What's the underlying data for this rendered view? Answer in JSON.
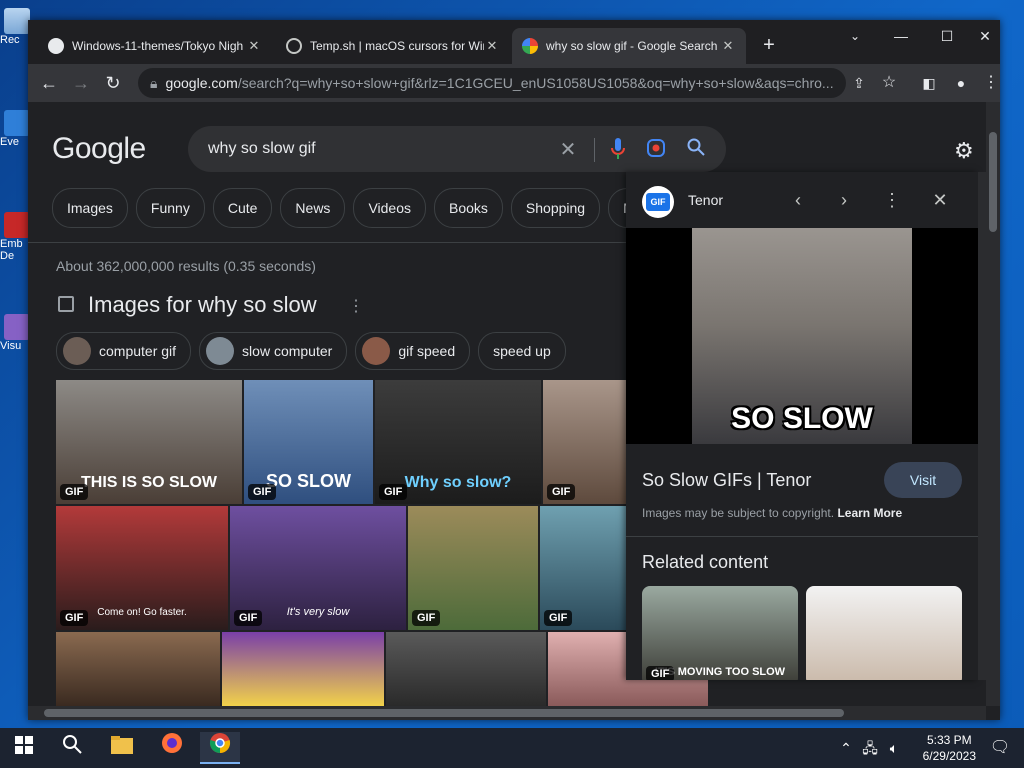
{
  "desktop": {
    "icons": [
      {
        "name": "recycle-bin",
        "label": "Rec"
      },
      {
        "name": "edge",
        "label": "Eve"
      },
      {
        "name": "embarcadero",
        "label": "Emb De"
      },
      {
        "name": "visual-studio",
        "label": "Visu"
      }
    ]
  },
  "browser": {
    "tabs": [
      {
        "title": "Windows-11-themes/Tokyo Nigh",
        "icon": "github-icon"
      },
      {
        "title": "Temp.sh | macOS cursors for Win",
        "icon": "globe-icon"
      },
      {
        "title": "why so slow gif - Google Search",
        "icon": "google-icon",
        "active": true
      }
    ],
    "address": {
      "domain": "google.com",
      "path": "/search?q=why+so+slow+gif&rlz=1C1GCEU_enUS1058US1058&oq=why+so+slow&aqs=chro..."
    }
  },
  "search": {
    "logo": "Google",
    "query": "why so slow gif",
    "chips": [
      "Images",
      "Funny",
      "Cute",
      "News",
      "Videos",
      "Books",
      "Shopping",
      "Ma"
    ],
    "stats": "About 362,000,000 results (0.35 seconds)",
    "images_title": "Images for why so slow",
    "refinements": [
      "computer gif",
      "slow computer",
      "gif speed",
      "speed up"
    ],
    "thumb_captions": [
      "THIS IS SO SLOW",
      "SO SLOW",
      "Why so slow?",
      "Come on! Go faster.",
      "It's very slow",
      "IT'S MOVING TOO SLOW"
    ],
    "gif_badge": "GIF"
  },
  "panel": {
    "source": "Tenor",
    "image_caption": "SO SLOW",
    "title": "So Slow GIFs | Tenor",
    "visit": "Visit",
    "copyright": "Images may be subject to copyright.",
    "learn_more": "Learn More",
    "related": "Related content"
  },
  "taskbar": {
    "time": "5:33 PM",
    "date": "6/29/2023"
  }
}
